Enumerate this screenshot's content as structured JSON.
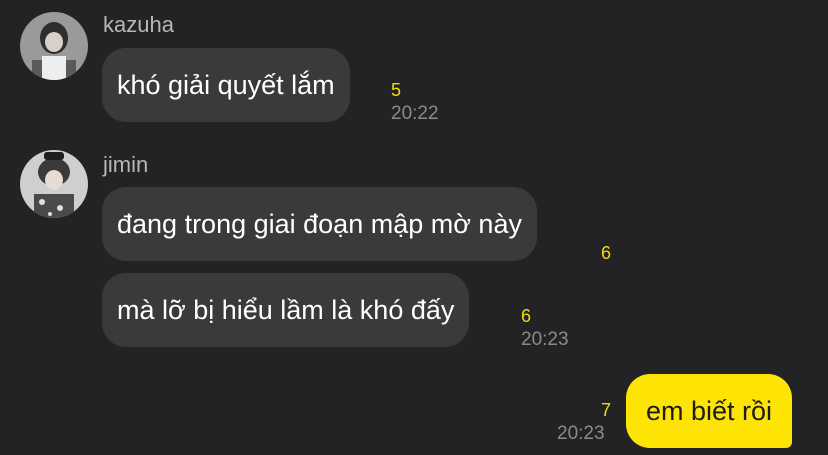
{
  "messages": [
    {
      "sender": "kazuha",
      "avatar": "avatar-kazuha",
      "text": "khó giải quyết lắm",
      "unread": "5",
      "time": "20:22"
    },
    {
      "sender": "jimin",
      "avatar": "avatar-jimin",
      "text": "đang trong giai đoạn mập mờ này",
      "unread": "6",
      "time": ""
    },
    {
      "sender": "jimin",
      "text": "mà lỡ bị hiểu lầm là khó đấy",
      "unread": "6",
      "time": "20:23"
    },
    {
      "sender": "me",
      "text": "em biết rồi",
      "unread": "7",
      "time": "20:23"
    }
  ],
  "colors": {
    "background": "#232325",
    "incoming_bubble": "#3a3a3c",
    "outgoing_bubble": "#fde404",
    "unread_count": "#f4d90f"
  }
}
